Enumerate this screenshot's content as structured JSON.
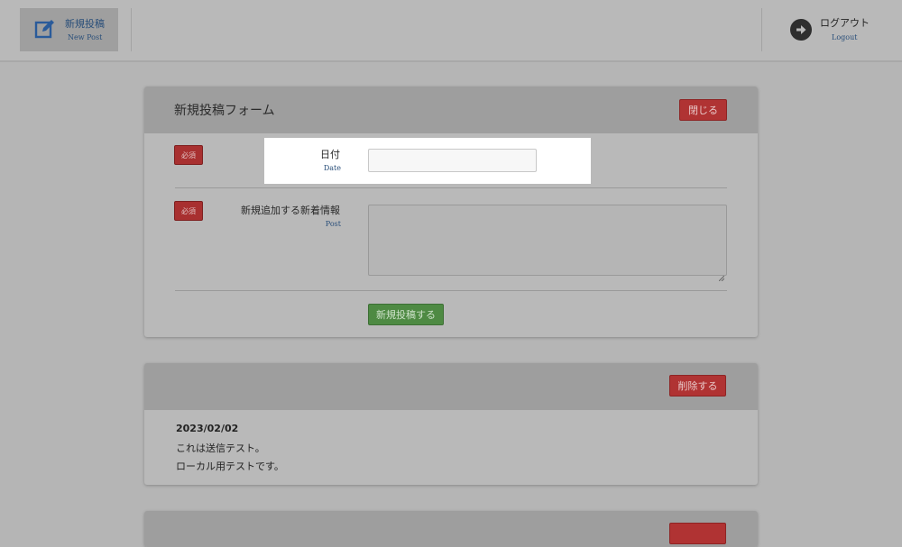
{
  "header": {
    "new_post": {
      "label": "新規投稿",
      "sub": "New Post",
      "icon": "edit-icon"
    },
    "logout": {
      "label": "ログアウト",
      "sub": "Logout",
      "icon": "arrow-right-circle-icon"
    }
  },
  "form": {
    "title": "新規投稿フォーム",
    "close_label": "閉じる",
    "date_field": {
      "badge": "必須",
      "label": "日付",
      "sub": "Date",
      "value": ""
    },
    "post_field": {
      "badge": "必須",
      "label": "新規追加する新着情報",
      "sub": "Post",
      "value": ""
    },
    "submit_label": "新規投稿する"
  },
  "posts": [
    {
      "delete_label": "削除する",
      "date": "2023/02/02",
      "lines": [
        "これは送信テスト。",
        "ローカル用テストです。"
      ]
    },
    {
      "delete_label": ""
    }
  ],
  "colors": {
    "danger": "#b03333",
    "success": "#4e8a43",
    "link": "#2a4f7a"
  }
}
